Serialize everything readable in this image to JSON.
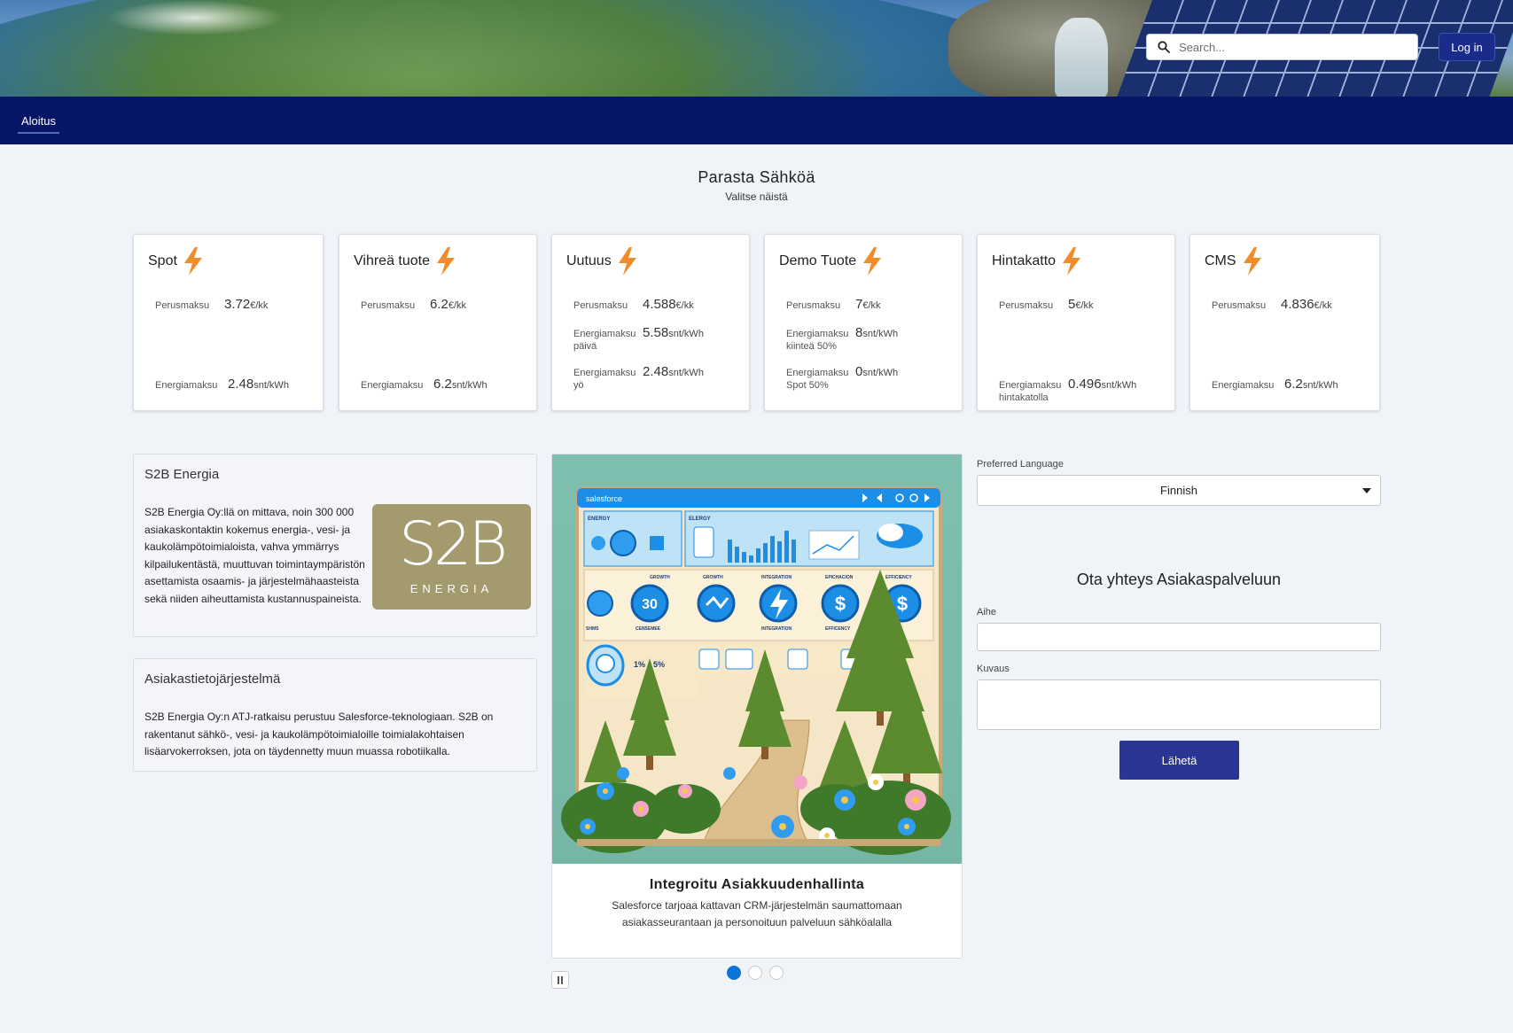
{
  "header": {
    "search_placeholder": "Search...",
    "login_label": "Log in",
    "search_icon": "search-icon"
  },
  "nav": {
    "items": [
      {
        "label": "Aloitus",
        "active": true
      }
    ]
  },
  "products_section": {
    "title": "Parasta Sähköä",
    "subtitle": "Valitse näistä",
    "icon": "lightning-bolt-icon",
    "accent_color": "#f28c28",
    "cards": [
      {
        "name": "Spot",
        "rows": [
          {
            "label": "Perusmaksu",
            "value": "3.72",
            "unit": "€/kk"
          },
          {
            "label": "Energiamaksu",
            "value": "2.48",
            "unit": "snt/kWh"
          }
        ]
      },
      {
        "name": "Vihreä tuote",
        "rows": [
          {
            "label": "Perusmaksu",
            "value": "6.2",
            "unit": "€/kk"
          },
          {
            "label": "Energiamaksu",
            "value": "6.2",
            "unit": "snt/kWh"
          }
        ]
      },
      {
        "name": "Uutuus",
        "rows": [
          {
            "label": "Perusmaksu",
            "value": "4.588",
            "unit": "€/kk"
          },
          {
            "label": "Energiamaksu päivä",
            "value": "5.58",
            "unit": "snt/kWh"
          },
          {
            "label": "Energiamaksu yö",
            "value": "2.48",
            "unit": "snt/kWh"
          }
        ]
      },
      {
        "name": "Demo Tuote",
        "rows": [
          {
            "label": "Perusmaksu",
            "value": "7",
            "unit": "€/kk"
          },
          {
            "label": "Energiamaksu kiinteä 50%",
            "value": "8",
            "unit": "snt/kWh"
          },
          {
            "label": "Energiamaksu Spot 50%",
            "value": "0",
            "unit": "snt/kWh"
          }
        ]
      },
      {
        "name": "Hintakatto",
        "rows": [
          {
            "label": "Perusmaksu",
            "value": "5",
            "unit": "€/kk"
          },
          {
            "label": "Energiamaksu hintakatolla",
            "value": "0.496",
            "unit": "snt/kWh"
          }
        ]
      },
      {
        "name": "CMS",
        "rows": [
          {
            "label": "Perusmaksu",
            "value": "4.836",
            "unit": "€/kk"
          },
          {
            "label": "Energiamaksu",
            "value": "6.2",
            "unit": "snt/kWh"
          }
        ]
      }
    ]
  },
  "company_panel": {
    "title": "S2B Energia",
    "text": "S2B Energia Oy:llä on mittava, noin 300 000 asiakaskontaktin kokemus energia-, vesi- ja kaukolämpötoimialoista, vahva ymmärrys kilpailukentästä, muuttuvan toimintaympäristön asettamista osaamis- ja järjestelmähaasteista sekä niiden aiheuttamista kustannuspaineista.",
    "logo_text": "S2B",
    "logo_subtext": "ENERGIA",
    "logo_color": "#a39a6e"
  },
  "crm_panel": {
    "title": "Asiakastietojärjestelmä",
    "text": "S2B Energia Oy:n ATJ-ratkaisu perustuu Salesforce-teknologiaan. S2B on rakentanut sähkö-, vesi- ja kaukolämpötoimialoille toimialakohtaisen lisäarvokerroksen, jota on täydennetty muun muassa robotiikalla."
  },
  "carousel": {
    "slide_title": "Integroitu Asiakkuudenhallinta",
    "slide_text": "Salesforce tarjoaa kattavan CRM-järjestelmän saumattomaan asiakasseurantaan ja personoituun palveluun sähköalalla",
    "image_labels": {
      "brand": "salesforce",
      "panel_energy": "ENERGY",
      "panel_elergy": "ELERGY",
      "growth": "GROWTH",
      "integration": "INTEGRATION",
      "epichacion": "EPICHACION",
      "efficiency": "EFFICIENCY",
      "number_30": "30",
      "shms": "SHMS",
      "censemee": "CENSEMEE",
      "growth2": "GROWTH",
      "integration2": "INTEGRATION",
      "efficency": "EFFICENCY",
      "percent1": "1%",
      "percent5": "5%"
    },
    "slide_count": 3,
    "active_slide": 1,
    "pause_icon": "pause-icon"
  },
  "form": {
    "language_label": "Preferred Language",
    "language_value": "Finnish",
    "contact_title": "Ota yhteys Asiakaspalveluun",
    "subject_label": "Aihe",
    "description_label": "Kuvaus",
    "submit_label": "Lähetä",
    "submit_color": "#2a3594"
  }
}
